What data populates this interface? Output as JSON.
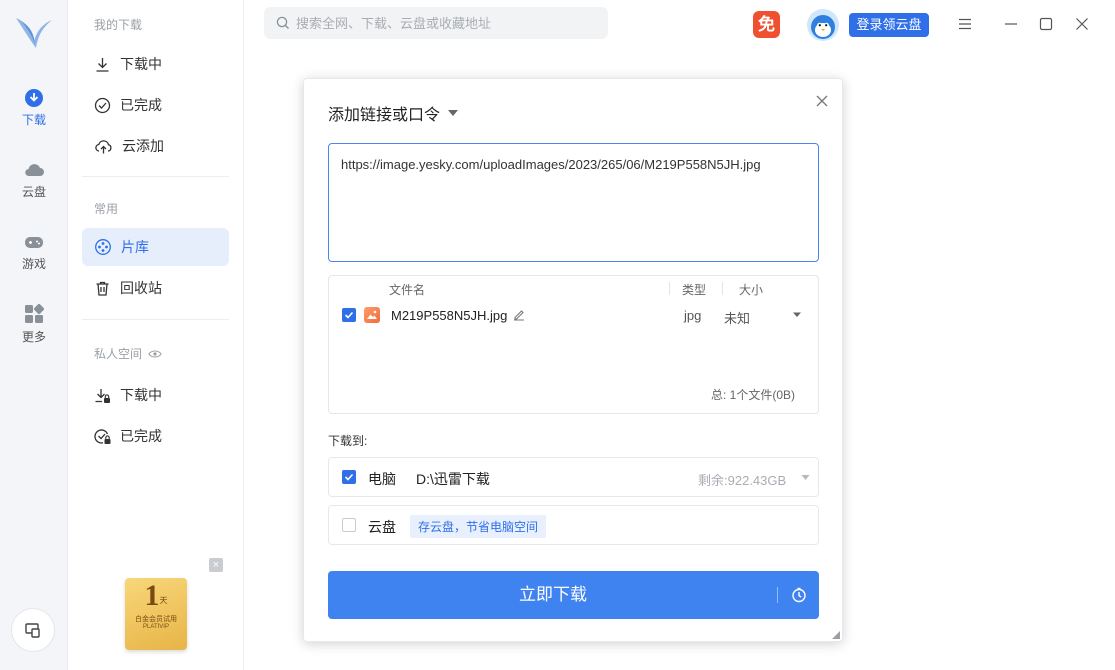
{
  "rail": {
    "items": [
      {
        "label": "下载"
      },
      {
        "label": "云盘"
      },
      {
        "label": "游戏"
      },
      {
        "label": "更多"
      }
    ]
  },
  "nav": {
    "section_my_downloads": "我的下载",
    "downloading": "下载中",
    "completed": "已完成",
    "cloud_add": "云添加",
    "section_common": "常用",
    "library": "片库",
    "recycle": "回收站",
    "section_private": "私人空间",
    "private_downloading": "下载中",
    "private_completed": "已完成"
  },
  "promo": {
    "big": "1",
    "unit": "天",
    "line1": "白金会员试用",
    "line2": "PLATIVIP"
  },
  "topbar": {
    "search_placeholder": "搜索全网、下载、云盘或收藏地址",
    "free_badge": "免",
    "login_button": "登录领云盘"
  },
  "dialog": {
    "title": "添加链接或口令",
    "url": "https://image.yesky.com/uploadImages/2023/265/06/M219P558N5JH.jpg",
    "file_table": {
      "col_name": "文件名",
      "col_type": "类型",
      "col_size": "大小",
      "rows": [
        {
          "name": "M219P558N5JH.jpg",
          "type": "jpg",
          "size": "未知",
          "checked": true
        }
      ],
      "total": "总:  1个文件(0B)"
    },
    "download_to_label": "下载到:",
    "dest_pc": {
      "label": "电脑",
      "path": "D:\\迅雷下载",
      "free_space": "剩余:922.43GB",
      "checked": true
    },
    "dest_cloud": {
      "label": "云盘",
      "tip": "存云盘，节省电脑空间",
      "checked": false
    },
    "download_button": "立即下载"
  },
  "colors": {
    "accent": "#2f6fe8",
    "button": "#3f83f0",
    "badge": "#f0502f"
  }
}
